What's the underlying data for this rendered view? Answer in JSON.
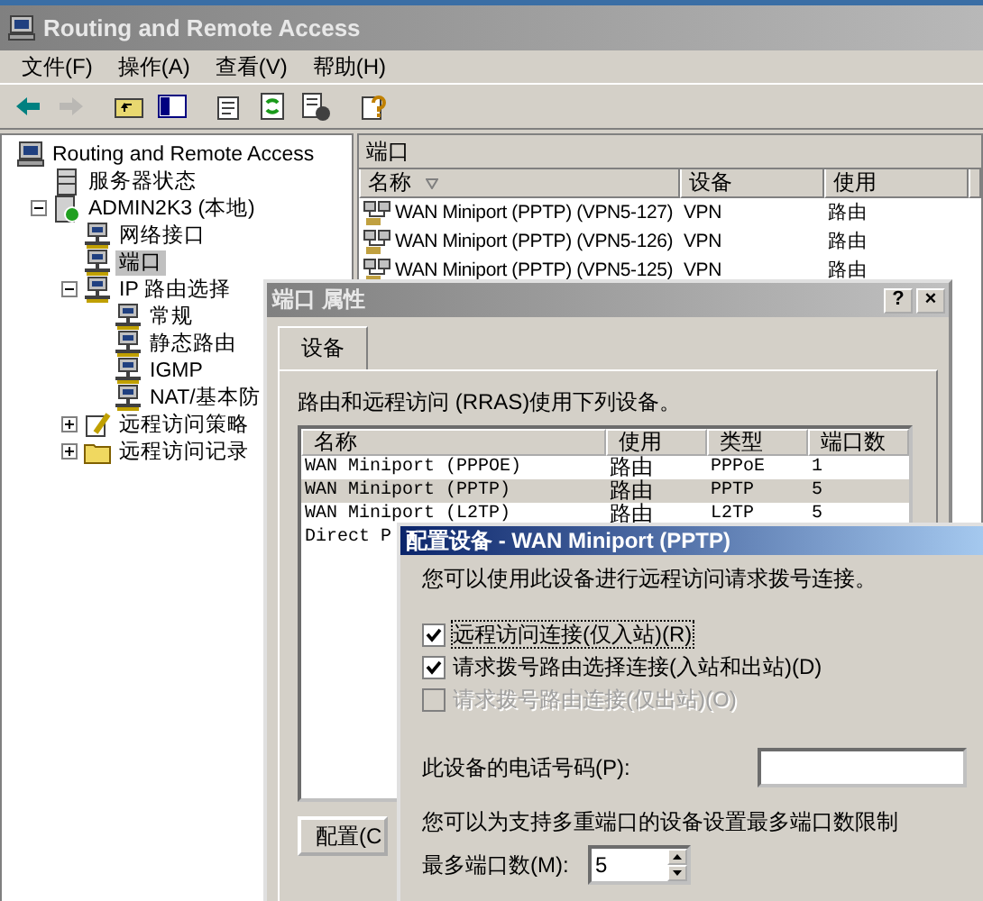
{
  "window": {
    "title": "Routing and Remote Access"
  },
  "menu": [
    "文件(F)",
    "操作(A)",
    "查看(V)",
    "帮助(H)"
  ],
  "toolbar": [
    {
      "disabled": false
    },
    {
      "disabled": true
    },
    {
      "disabled": false
    },
    {
      "disabled": false
    },
    {
      "disabled": false
    },
    {
      "disabled": false
    },
    {
      "disabled": false
    },
    {
      "disabled": false
    }
  ],
  "tree": [
    {
      "label": "Routing and Remote Access",
      "kind": "console",
      "selected": false,
      "children": [
        {
          "label": "服务器状态",
          "kind": "status",
          "selected": false
        },
        {
          "label": "ADMIN2K3 (本地)",
          "kind": "server",
          "selected": false,
          "expanded": true,
          "children": [
            {
              "label": "网络接口",
              "kind": "node",
              "selected": false
            },
            {
              "label": "端口",
              "kind": "node",
              "selected": true
            },
            {
              "label": "IP 路由选择",
              "kind": "node",
              "selected": false,
              "expanded": true,
              "children": [
                {
                  "label": "常规",
                  "kind": "node",
                  "selected": false
                },
                {
                  "label": "静态路由",
                  "kind": "node",
                  "selected": false
                },
                {
                  "label": "IGMP",
                  "kind": "node",
                  "selected": false
                },
                {
                  "label": "NAT/基本防",
                  "kind": "node",
                  "selected": false
                }
              ]
            },
            {
              "label": "远程访问策略",
              "kind": "policy",
              "selected": false,
              "expanded": false
            },
            {
              "label": "远程访问记录",
              "kind": "folder",
              "selected": false,
              "expanded": false
            }
          ]
        }
      ]
    }
  ],
  "details": {
    "title": "端口",
    "columns": [
      {
        "label": "名称",
        "sorted": true
      },
      {
        "label": "设备",
        "sorted": false
      },
      {
        "label": "使用",
        "sorted": false
      }
    ],
    "rows": [
      [
        "WAN Miniport (PPTP) (VPN5-127)",
        "VPN",
        "路由"
      ],
      [
        "WAN Miniport (PPTP) (VPN5-126)",
        "VPN",
        "路由"
      ],
      [
        "WAN Miniport (PPTP) (VPN5-125)",
        "VPN",
        "路由"
      ]
    ]
  },
  "properties_dialog": {
    "title": "端口 属性",
    "title_buttons": [
      "?",
      "×"
    ],
    "tabs": [
      {
        "label": "设备",
        "selected": true
      }
    ],
    "description": "路由和远程访问 (RRAS)使用下列设备。",
    "columns": [
      "名称",
      "使用",
      "类型",
      "端口数"
    ],
    "rows": [
      {
        "cells": [
          "WAN Miniport (PPPOE)",
          "路由",
          "PPPoE",
          "1"
        ],
        "selected": false
      },
      {
        "cells": [
          "WAN Miniport (PPTP)",
          "路由",
          "PPTP",
          "5"
        ],
        "selected": true
      },
      {
        "cells": [
          "WAN Miniport (L2TP)",
          "路由",
          "L2TP",
          "5"
        ],
        "selected": false
      },
      {
        "cells": [
          "Direct P"
        ],
        "selected": false
      }
    ],
    "button": "配置(C"
  },
  "configure_dialog": {
    "title": "配置设备 - WAN Miniport (PPTP)",
    "intro": "您可以使用此设备进行远程访问请求拨号连接。",
    "options": [
      {
        "label": "远程访问连接(仅入站)(R)",
        "checked": true,
        "disabled": false,
        "focused": true
      },
      {
        "label": "请求拨号路由选择连接(入站和出站)(D)",
        "checked": true,
        "disabled": false,
        "focused": false
      },
      {
        "label": "请求拨号路由连接(仅出站)(O)",
        "checked": false,
        "disabled": true,
        "focused": false
      }
    ],
    "phone_label": "此设备的电话号码(P):",
    "limit_text": "您可以为支持多重端口的设备设置最多端口数限制",
    "max_label": "最多端口数(M):",
    "max_value": "5"
  }
}
